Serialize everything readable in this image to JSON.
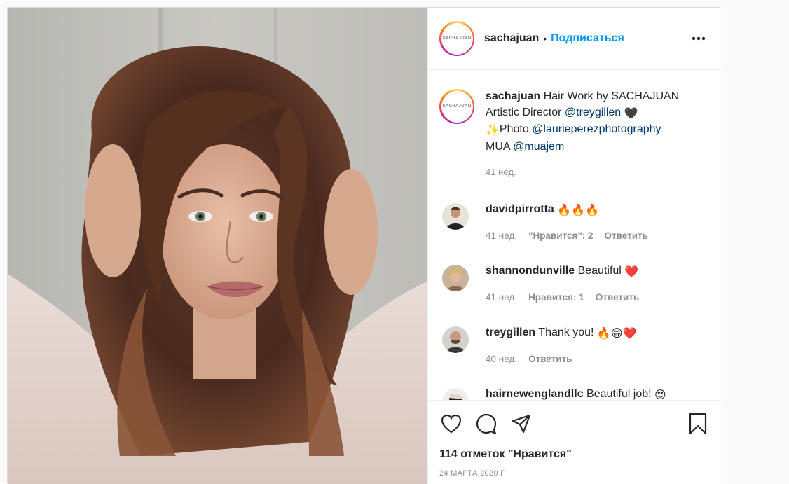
{
  "post": {
    "author": "sachajuan",
    "avatar_text": "SACHAJUAN",
    "dot": "•",
    "follow_label": "Подписаться",
    "more_label": "•••",
    "photo": "portrait-of-woman-with-long-brown-hair"
  },
  "caption": {
    "username": "sachajuan",
    "line1_text": "Hair Work by SACHAJUAN",
    "line2_text": "Artistic Director",
    "line2_mention": "@treygillen",
    "line2_emoji": "🖤",
    "line3_emoji": "✨",
    "line3_text": "Photo",
    "line3_mention": "@laurieperezphotography",
    "line4_text": "MUA",
    "line4_mention": "@muajem",
    "time": "41 нед."
  },
  "comments": [
    {
      "username": "davidpirrotta",
      "text": "",
      "emoji": "🔥🔥🔥",
      "time": "41 нед.",
      "likes": "\"Нравится\": 2",
      "reply": "Ответить"
    },
    {
      "username": "shannondunville",
      "text": "Beautiful",
      "emoji": "❤️",
      "time": "41 нед.",
      "likes": "Нравится: 1",
      "reply": "Ответить"
    },
    {
      "username": "treygillen",
      "text": "Thank you!",
      "emoji": "🔥😁❤️",
      "time": "40 нед.",
      "likes": "",
      "reply": "Ответить"
    },
    {
      "username": "hairnewenglandllc",
      "text": "Beautiful job!",
      "emoji": "😍",
      "time": "",
      "likes": "",
      "reply": ""
    }
  ],
  "actions": {
    "like_icon": "heart-icon",
    "comment_icon": "comment-icon",
    "share_icon": "share-icon",
    "save_icon": "bookmark-icon",
    "likes_count": "114 отметок \"Нравится\"",
    "date": "24 марта 2020 г."
  },
  "colors": {
    "accent": "#0095f6",
    "mention": "#00376b",
    "muted": "#8e8e8e",
    "border": "#dbdbdb"
  }
}
